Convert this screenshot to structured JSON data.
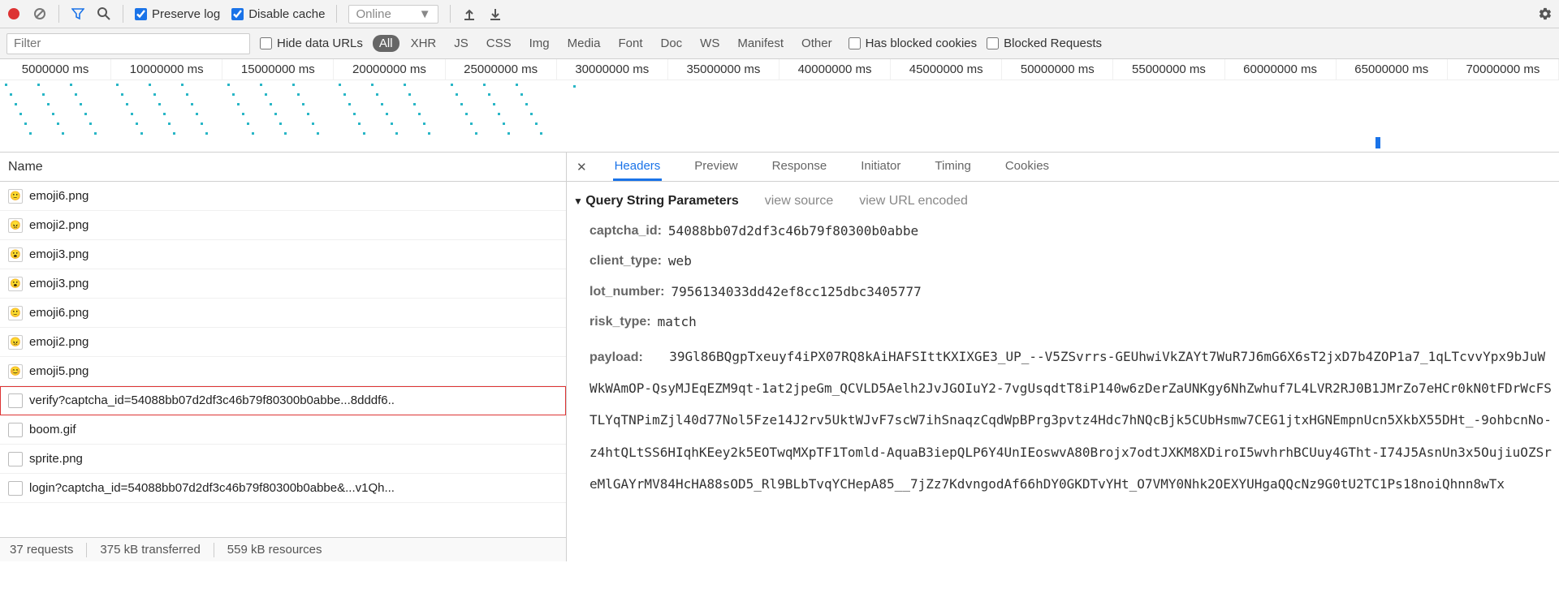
{
  "toolbar": {
    "preserve_log_label": "Preserve log",
    "preserve_log_checked": true,
    "disable_cache_label": "Disable cache",
    "disable_cache_checked": true,
    "online_label": "Online"
  },
  "filterbar": {
    "filter_placeholder": "Filter",
    "hide_data_urls_label": "Hide data URLs",
    "types": [
      "All",
      "XHR",
      "JS",
      "CSS",
      "Img",
      "Media",
      "Font",
      "Doc",
      "WS",
      "Manifest",
      "Other"
    ],
    "active_type": "All",
    "has_blocked_cookies_label": "Has blocked cookies",
    "blocked_requests_label": "Blocked Requests"
  },
  "timeline": {
    "ticks": [
      "5000000 ms",
      "10000000 ms",
      "15000000 ms",
      "20000000 ms",
      "25000000 ms",
      "30000000 ms",
      "35000000 ms",
      "40000000 ms",
      "45000000 ms",
      "50000000 ms",
      "55000000 ms",
      "60000000 ms",
      "65000000 ms",
      "70000000 ms"
    ]
  },
  "left": {
    "header": "Name",
    "requests": [
      {
        "icon": "🙂",
        "name": "emoji6.png"
      },
      {
        "icon": "😠",
        "name": "emoji2.png"
      },
      {
        "icon": "😮",
        "name": "emoji3.png"
      },
      {
        "icon": "😮",
        "name": "emoji3.png"
      },
      {
        "icon": "🙂",
        "name": "emoji6.png"
      },
      {
        "icon": "😠",
        "name": "emoji2.png"
      },
      {
        "icon": "😊",
        "name": "emoji5.png"
      },
      {
        "icon": "",
        "name": "verify?captcha_id=54088bb07d2df3c46b79f80300b0abbe...8dddf6..",
        "selected": true
      },
      {
        "icon": "",
        "name": "boom.gif"
      },
      {
        "icon": "",
        "name": "sprite.png"
      },
      {
        "icon": "",
        "name": "login?captcha_id=54088bb07d2df3c46b79f80300b0abbe&...v1Qh..."
      }
    ],
    "status": {
      "requests": "37 requests",
      "transferred": "375 kB transferred",
      "resources": "559 kB resources"
    }
  },
  "right": {
    "tabs": [
      "Headers",
      "Preview",
      "Response",
      "Initiator",
      "Timing",
      "Cookies"
    ],
    "active_tab": "Headers",
    "section_title": "Query String Parameters",
    "view_source": "view source",
    "view_url_encoded": "view URL encoded",
    "params": [
      {
        "k": "captcha_id:",
        "v": "54088bb07d2df3c46b79f80300b0abbe"
      },
      {
        "k": "client_type:",
        "v": "web"
      },
      {
        "k": "lot_number:",
        "v": "7956134033dd42ef8cc125dbc3405777"
      },
      {
        "k": "risk_type:",
        "v": "match"
      }
    ],
    "payload_key": "payload:",
    "payload_value": "39Gl86BQgpTxeuyf4iPX07RQ8kAiHAFSIttKXIXGE3_UP_--V5ZSvrrs-GEUhwiVkZAYt7WuR7J6mG6X6sT2jxD7b4ZOP1a7_1qLTcvvYpx9bJuWWkWAmOP-QsyMJEqEZM9qt-1at2jpeGm_QCVLD5Aelh2JvJGOIuY2-7vgUsqdtT8iP140w6zDerZaUNKgy6NhZwhuf7L4LVR2RJ0B1JMrZo7eHCr0kN0tFDrWcFSTLYqTNPimZjl40d77Nol5Fze14J2rv5UktWJvF7scW7ihSnaqzCqdWpBPrg3pvtz4Hdc7hNQcBjk5CUbHsmw7CEG1jtxHGNEmpnUcn5XkbX55DHt_-9ohbcnNo-z4htQLtSS6HIqhKEey2k5EOTwqMXpTF1Tomld-AquaB3iepQLP6Y4UnIEoswvA80Brojx7odtJXKM8XDiroI5wvhrhBCUuy4GTht-I74J5AsnUn3x5OujiuOZSreMlGAYrMV84HcHA88sOD5_Rl9BLbTvqYCHepA85__7jZz7KdvngodAf66hDY0GKDTvYHt_O7VMY0Nhk2OEXYUHgaQQcNz9G0tU2TC1Ps18noiQhnn8wTx"
  }
}
